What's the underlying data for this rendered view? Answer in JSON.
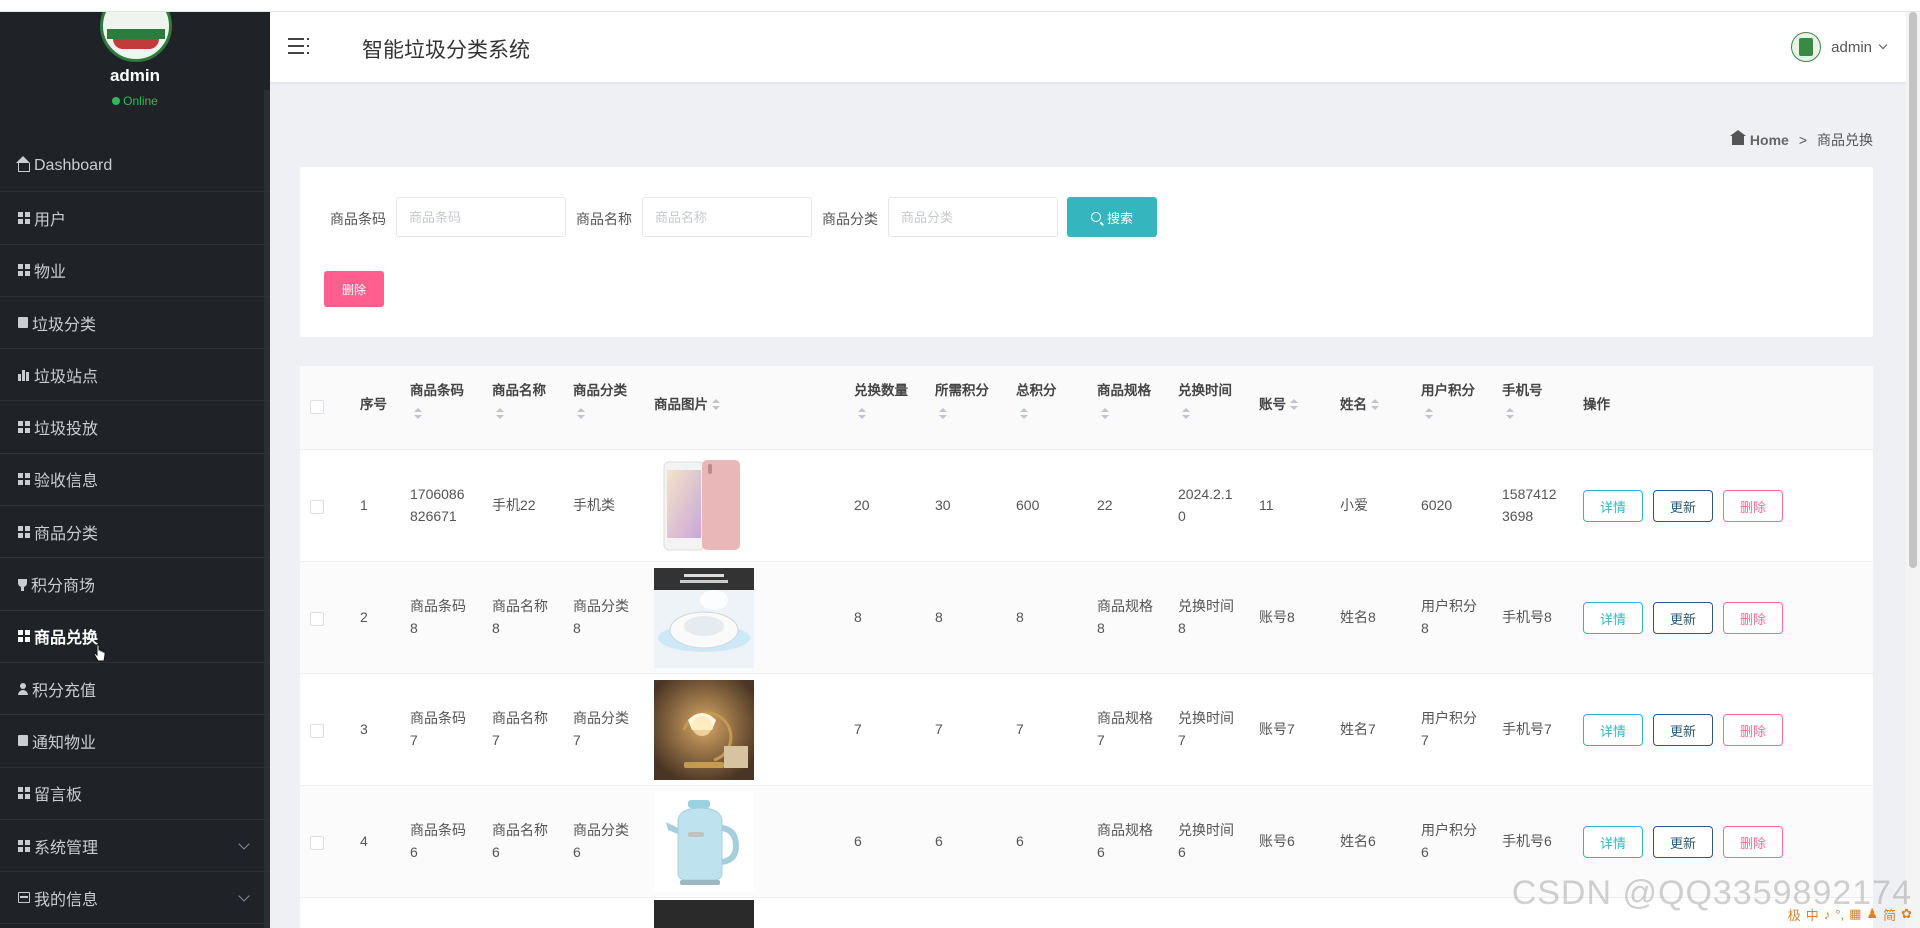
{
  "app": {
    "title": "智能垃圾分类系统"
  },
  "sidebar": {
    "user": {
      "name": "admin",
      "status": "Online"
    },
    "items": [
      {
        "label": "Dashboard",
        "icon": "home-icon"
      },
      {
        "label": "用户",
        "icon": "grid-icon"
      },
      {
        "label": "物业",
        "icon": "grid-icon"
      },
      {
        "label": "垃圾分类",
        "icon": "document-icon"
      },
      {
        "label": "垃圾站点",
        "icon": "bar-chart-icon"
      },
      {
        "label": "垃圾投放",
        "icon": "grid-icon"
      },
      {
        "label": "验收信息",
        "icon": "grid-icon"
      },
      {
        "label": "商品分类",
        "icon": "grid-icon"
      },
      {
        "label": "积分商场",
        "icon": "trophy-icon"
      },
      {
        "label": "商品兑换",
        "icon": "grid-icon",
        "active": true
      },
      {
        "label": "积分充值",
        "icon": "user-icon"
      },
      {
        "label": "通知物业",
        "icon": "document-icon"
      },
      {
        "label": "留言板",
        "icon": "grid-icon"
      },
      {
        "label": "系统管理",
        "icon": "grid-icon",
        "expandable": true
      },
      {
        "label": "我的信息",
        "icon": "card-icon",
        "expandable": true
      }
    ]
  },
  "header": {
    "username": "admin"
  },
  "breadcrumb": {
    "home": "Home",
    "separator": ">",
    "current": "商品兑换"
  },
  "search": {
    "fields": [
      {
        "label": "商品条码",
        "placeholder": "商品条码"
      },
      {
        "label": "商品名称",
        "placeholder": "商品名称"
      },
      {
        "label": "商品分类",
        "placeholder": "商品分类"
      }
    ],
    "search_label": "搜索",
    "delete_label": "删除"
  },
  "table": {
    "headers": [
      "序号",
      "商品条码",
      "商品名称",
      "商品分类",
      "商品图片",
      "兑换数量",
      "所需积分",
      "总积分",
      "商品规格",
      "兑换时间",
      "账号",
      "姓名",
      "用户积分",
      "手机号",
      "操作"
    ],
    "rows": [
      {
        "no": "1",
        "code": [
          "1706086",
          "826671"
        ],
        "name": [
          "手机22",
          ""
        ],
        "category": [
          "手机类",
          ""
        ],
        "qty": "20",
        "points": "30",
        "total": "600",
        "spec": [
          "22",
          ""
        ],
        "time": [
          "2024.2.1",
          "0"
        ],
        "account": "11",
        "person": "小爱",
        "user_points": [
          "6020",
          ""
        ],
        "phone": [
          "1587412",
          "3698"
        ],
        "image": "phone"
      },
      {
        "no": "2",
        "code": [
          "商品条码",
          "8"
        ],
        "name": [
          "商品名称",
          "8"
        ],
        "category": [
          "商品分类",
          "8"
        ],
        "qty": "8",
        "points": "8",
        "total": "8",
        "spec": [
          "商品规格",
          "8"
        ],
        "time": [
          "兑换时间",
          "8"
        ],
        "account": "账号8",
        "person": "姓名8",
        "user_points": [
          "用户积分",
          "8"
        ],
        "phone": [
          "手机号8",
          ""
        ],
        "image": "robot"
      },
      {
        "no": "3",
        "code": [
          "商品条码",
          "7"
        ],
        "name": [
          "商品名称",
          "7"
        ],
        "category": [
          "商品分类",
          "7"
        ],
        "qty": "7",
        "points": "7",
        "total": "7",
        "spec": [
          "商品规格",
          "7"
        ],
        "time": [
          "兑换时间",
          "7"
        ],
        "account": "账号7",
        "person": "姓名7",
        "user_points": [
          "用户积分",
          "7"
        ],
        "phone": [
          "手机号7",
          ""
        ],
        "image": "lamp"
      },
      {
        "no": "4",
        "code": [
          "商品条码",
          "6"
        ],
        "name": [
          "商品名称",
          "6"
        ],
        "category": [
          "商品分类",
          "6"
        ],
        "qty": "6",
        "points": "6",
        "total": "6",
        "spec": [
          "商品规格",
          "6"
        ],
        "time": [
          "兑换时间",
          "6"
        ],
        "account": "账号6",
        "person": "姓名6",
        "user_points": [
          "用户积分",
          "6"
        ],
        "phone": [
          "手机号6",
          ""
        ],
        "image": "kettle"
      }
    ],
    "actions": {
      "detail": "详情",
      "update": "更新",
      "delete": "删除"
    }
  },
  "watermark": "CSDN @QQ3359892174",
  "tray": [
    "极",
    "中",
    "♪",
    "°,",
    "▦",
    "♟",
    "简",
    "✿"
  ]
}
